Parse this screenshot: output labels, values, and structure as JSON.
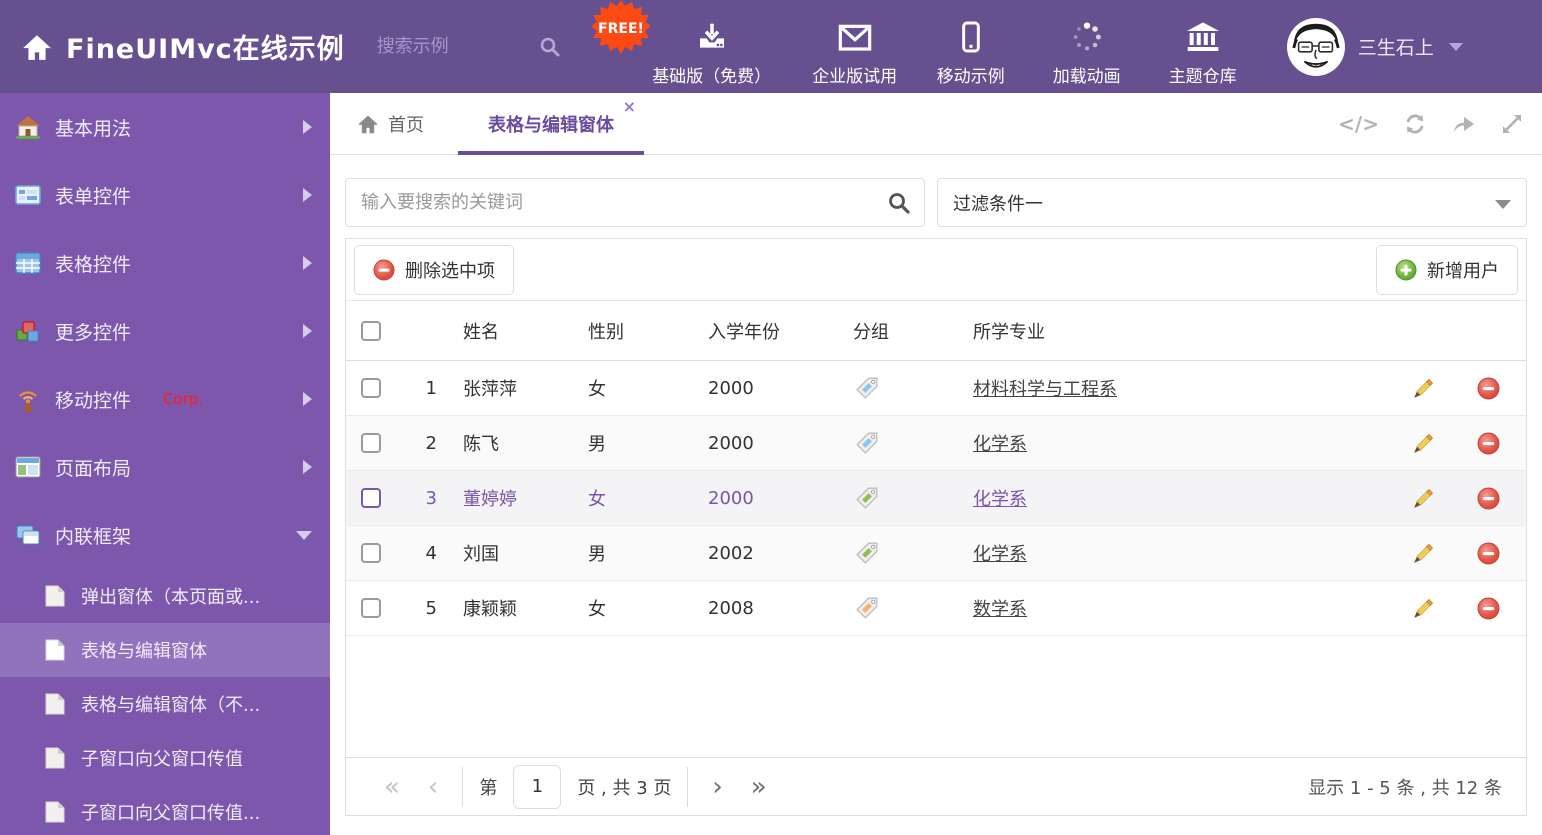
{
  "header": {
    "logo_text": "FineUIMvc在线示例",
    "search_placeholder": "搜索示例",
    "free_badge": "FREE!",
    "nav": [
      {
        "label": "基础版（免费）",
        "icon": "download-icon"
      },
      {
        "label": "企业版试用",
        "icon": "envelope-icon"
      },
      {
        "label": "移动示例",
        "icon": "mobile-icon"
      },
      {
        "label": "加载动画",
        "icon": "spinner-icon"
      },
      {
        "label": "主题仓库",
        "icon": "bank-icon"
      }
    ],
    "user_name": "三生石上"
  },
  "sidebar": {
    "items": [
      {
        "label": "基本用法",
        "icon": "home-icon"
      },
      {
        "label": "表单控件",
        "icon": "form-icon"
      },
      {
        "label": "表格控件",
        "icon": "table-icon"
      },
      {
        "label": "更多控件",
        "icon": "cubes-icon"
      },
      {
        "label": "移动控件",
        "badge": "Corp.",
        "icon": "antenna-icon"
      },
      {
        "label": "页面布局",
        "icon": "layout-icon"
      },
      {
        "label": "内联框架",
        "icon": "frames-icon",
        "expanded": true,
        "children": [
          {
            "label": "弹出窗体（本页面或..."
          },
          {
            "label": "表格与编辑窗体",
            "selected": true
          },
          {
            "label": "表格与编辑窗体（不..."
          },
          {
            "label": "子窗口向父窗口传值"
          },
          {
            "label": "子窗口向父窗口传值..."
          }
        ]
      }
    ]
  },
  "tabs": {
    "home_label": "首页",
    "active_label": "表格与编辑窗体",
    "close_glyph": "×"
  },
  "filters": {
    "search_placeholder": "输入要搜索的关键词",
    "filter_value": "过滤条件一"
  },
  "grid": {
    "delete_button": "删除选中项",
    "add_button": "新增用户",
    "columns": [
      "姓名",
      "性别",
      "入学年份",
      "分组",
      "所学专业"
    ],
    "rows": [
      {
        "num": "1",
        "name": "张萍萍",
        "gender": "女",
        "year": "2000",
        "tag_color": "#85c8f2",
        "major": "材料科学与工程系",
        "selected": false
      },
      {
        "num": "2",
        "name": "陈飞",
        "gender": "男",
        "year": "2000",
        "tag_color": "#85c8f2",
        "major": "化学系",
        "selected": false
      },
      {
        "num": "3",
        "name": "董婷婷",
        "gender": "女",
        "year": "2000",
        "tag_color": "#8fbe53",
        "major": "化学系",
        "selected": true
      },
      {
        "num": "4",
        "name": "刘国",
        "gender": "男",
        "year": "2002",
        "tag_color": "#8fbe53",
        "major": "化学系",
        "selected": false
      },
      {
        "num": "5",
        "name": "康颖颖",
        "gender": "女",
        "year": "2008",
        "tag_color": "#ffac67",
        "major": "数学系",
        "selected": false
      }
    ]
  },
  "pagination": {
    "first": "«",
    "prev": "‹",
    "next": "›",
    "last": "»",
    "page_prefix": "第",
    "page_value": "1",
    "page_suffix": "页 , 共 3 页",
    "summary": "显示 1 - 5 条 , 共 12 条"
  },
  "colors": {
    "header_bg": "#67508f",
    "sidebar_bg": "#7c57ac",
    "sidebar_selected": "#9173bd",
    "accent": "#6b4d9e",
    "delete_red": "#dd4b3e",
    "add_green": "#5da734",
    "free_badge": "#fb4a14"
  },
  "code_tool_glyph": "</>"
}
